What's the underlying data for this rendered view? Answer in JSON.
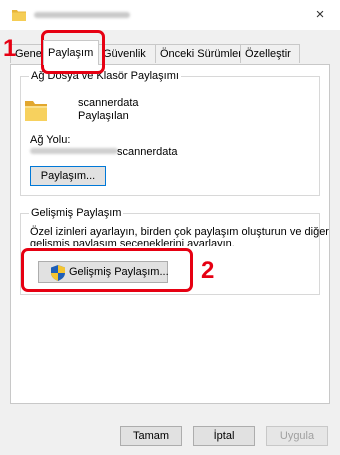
{
  "window": {
    "close_glyph": "×"
  },
  "tabs": [
    {
      "label": "Genel"
    },
    {
      "label": "Paylaşım"
    },
    {
      "label": "Güvenlik"
    },
    {
      "label": "Önceki Sürümler"
    },
    {
      "label": "Özelleştir"
    }
  ],
  "network_share": {
    "group_title": "Ağ Dosya ve Klasör Paylaşımı",
    "folder_name": "scannerdata",
    "status": "Paylaşılan",
    "path_label": "Ağ Yolu:",
    "path_value": "scannerdata",
    "share_button": "Paylaşım..."
  },
  "advanced_share": {
    "group_title": "Gelişmiş Paylaşım",
    "description_line1": "Özel izinleri ayarlayın, birden çok paylaşım oluşturun ve diğer",
    "description_line2": "gelişmiş paylaşım seçeneklerini ayarlayın.",
    "button": "Gelişmiş Paylaşım..."
  },
  "footer": {
    "ok": "Tamam",
    "cancel": "İptal",
    "apply": "Uygula"
  },
  "annotations": {
    "step1": "1",
    "step2": "2",
    "highlight_color": "#e60012"
  },
  "icons": [
    "folder-icon",
    "uac-shield-icon",
    "close-icon"
  ]
}
